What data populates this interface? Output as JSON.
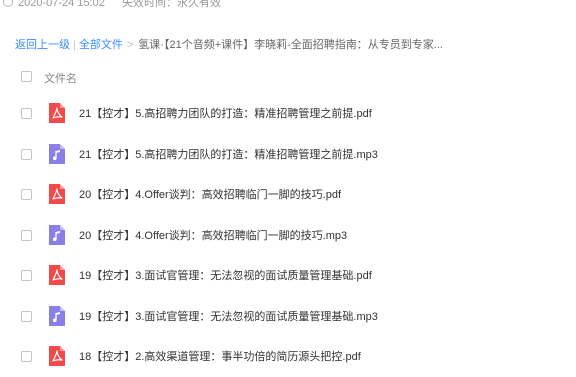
{
  "top": {
    "datetime": "2020-07-24 15:02",
    "expiry": "失效时间：永久有效"
  },
  "breadcrumb": {
    "back": "返回上一级",
    "separator": "|",
    "all_files": "全部文件",
    "arrow": ">",
    "current": "氢课·【21个音频+课件】李晓莉-全面招聘指南：从专员到专家..."
  },
  "list": {
    "header": "文件名",
    "files": [
      {
        "name": "21【控才】5.高招聘力团队的打造：精准招聘管理之前提.pdf",
        "type": "pdf",
        "icon": "pdf-file-icon"
      },
      {
        "name": "21【控才】5.高招聘力团队的打造：精准招聘管理之前提.mp3",
        "type": "mp3",
        "icon": "music-file-icon"
      },
      {
        "name": "20【控才】4.Offer谈判：高效招聘临门一脚的技巧.pdf",
        "type": "pdf",
        "icon": "pdf-file-icon"
      },
      {
        "name": "20【控才】4.Offer谈判：高效招聘临门一脚的技巧.mp3",
        "type": "mp3",
        "icon": "music-file-icon"
      },
      {
        "name": "19【控才】3.面试官管理：无法忽视的面试质量管理基础.pdf",
        "type": "pdf",
        "icon": "pdf-file-icon"
      },
      {
        "name": "19【控才】3.面试官管理：无法忽视的面试质量管理基础.mp3",
        "type": "mp3",
        "icon": "music-file-icon"
      },
      {
        "name": "18【控才】2.高效渠道管理：事半功倍的简历源头把控.pdf",
        "type": "pdf",
        "icon": "pdf-file-icon"
      }
    ]
  },
  "colors": {
    "pdf": "#f04a4a",
    "mp3": "#8a7fe6",
    "link": "#3b8cff"
  }
}
